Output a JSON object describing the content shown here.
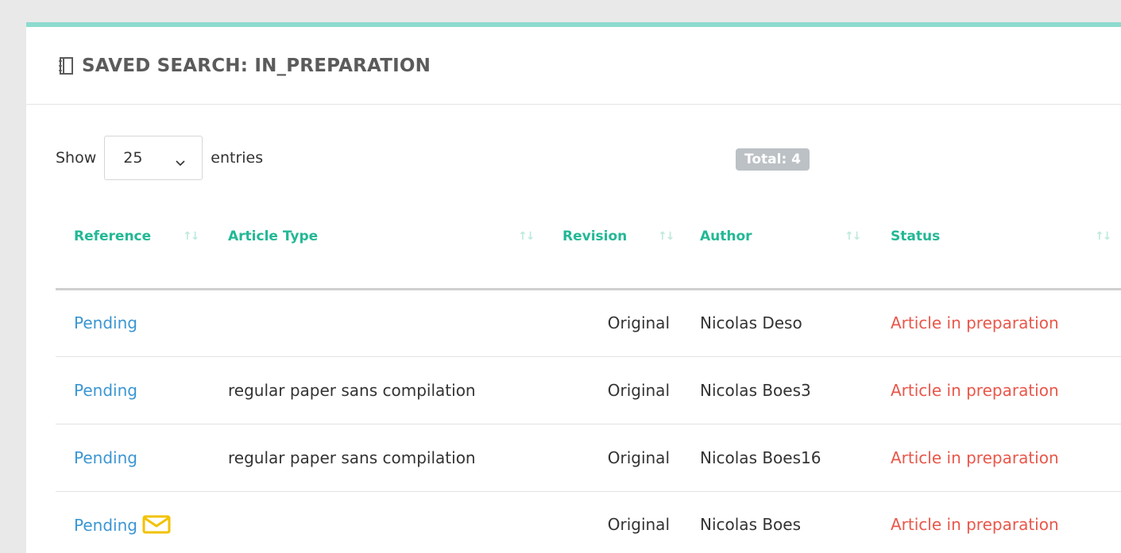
{
  "panel": {
    "title": "SAVED SEARCH: IN_PREPARATION",
    "icon": "notebook-icon"
  },
  "controls": {
    "show_label": "Show",
    "entries_value": "25",
    "entries_label": "entries",
    "total_label": "Total: 4"
  },
  "table": {
    "headers": [
      "Reference",
      "Article Type",
      "Revision",
      "Author",
      "Status"
    ],
    "rows": [
      {
        "reference": "Pending",
        "article_type": "",
        "revision": "Original",
        "author": "Nicolas Deso",
        "status": "Article in preparation",
        "has_mail_icon": false
      },
      {
        "reference": "Pending",
        "article_type": "regular paper sans compilation",
        "revision": "Original",
        "author": "Nicolas Boes3",
        "status": "Article in preparation",
        "has_mail_icon": false
      },
      {
        "reference": "Pending",
        "article_type": "regular paper sans compilation",
        "revision": "Original",
        "author": "Nicolas Boes16",
        "status": "Article in preparation",
        "has_mail_icon": false
      },
      {
        "reference": "Pending",
        "article_type": "",
        "revision": "Original",
        "author": "Nicolas Boes",
        "status": "Article in preparation",
        "has_mail_icon": true
      }
    ]
  },
  "colors": {
    "accent_border": "#8ddbcf",
    "header_text": "#23b895",
    "link": "#3b96d2",
    "status": "#e8574a",
    "mail_icon": "#f2c200",
    "badge": "#bcc1c5"
  }
}
